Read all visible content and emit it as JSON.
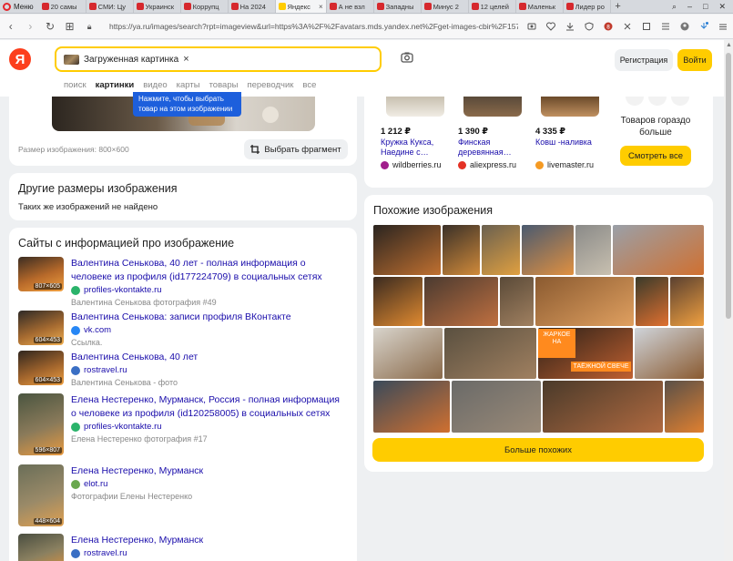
{
  "browser": {
    "menu_label": "Меню",
    "tabs": [
      {
        "title": "20 самы",
        "fav": "red"
      },
      {
        "title": "СМИ: Цу",
        "fav": "red"
      },
      {
        "title": "Украинск",
        "fav": "red"
      },
      {
        "title": "Коррупц",
        "fav": "red"
      },
      {
        "title": "На 2024",
        "fav": "red"
      },
      {
        "title": "Яндекс",
        "fav": "ya",
        "active": true
      },
      {
        "title": "А не взл",
        "fav": "red"
      },
      {
        "title": "Западны",
        "fav": "red"
      },
      {
        "title": "Минус 2",
        "fav": "red"
      },
      {
        "title": "12 целей",
        "fav": "red"
      },
      {
        "title": "Маленьк",
        "fav": "red"
      },
      {
        "title": "Лидер ро",
        "fav": "red"
      }
    ],
    "url": "https://ya.ru/images/search?rpt=imageview&url=https%3A%2F%2Favatars.mds.yandex.net%2Fget-images-cbir%2F1574220%2F1WjvlvL",
    "tab_close": "×",
    "new_tab": "+"
  },
  "header": {
    "logo": "Я",
    "search_chip": "Загруженная картинка",
    "chip_close": "×",
    "register": "Регистрация",
    "login": "Войти",
    "nav": [
      "поиск",
      "картинки",
      "видео",
      "карты",
      "товары",
      "переводчик",
      "все"
    ],
    "active_nav": "картинки"
  },
  "source": {
    "hint": "Нажмите, чтобы выбрать товар на этом изображении",
    "size_text": "Размер изображения: 800×600",
    "fragment_button": "Выбрать фрагмент"
  },
  "other_sizes": {
    "title": "Другие размеры изображения",
    "empty": "Таких же изображений не найдено"
  },
  "sites": {
    "title": "Сайты с информацией про изображение",
    "items": [
      {
        "title": "Валентина Сенькова, 40 лет - полная информация о человеке из профиля (id177224709) в социальных сетях",
        "domain": "profiles-vkontakte.ru",
        "snippet": "Валентина Сенькова фотография #49",
        "dim": "807×605",
        "fav_color": "#2ab36a"
      },
      {
        "title": "Валентина Сенькова: записи профиля ВКонтакте",
        "domain": "vk.com",
        "snippet": "Ссылка.",
        "dim": "604×453",
        "fav_color": "#2787f5"
      },
      {
        "title": "Валентина Сенькова, 40 лет",
        "domain": "rostravel.ru",
        "snippet": "Валентина Сенькова - фото",
        "dim": "604×453",
        "fav_color": "#3a6fc4"
      },
      {
        "title": "Елена Нестеренко, Мурманск, Россия - полная информация о человеке из профиля (id120258005) в социальных сетях",
        "domain": "profiles-vkontakte.ru",
        "snippet": "Елена Нестеренко фотография #17",
        "dim": "596×807",
        "fav_color": "#2ab36a"
      },
      {
        "title": "Елена Нестеренко, Мурманск",
        "domain": "elot.ru",
        "snippet": "Фотографии Елены Нестеренко",
        "dim": "448×604",
        "fav_color": "#6aa84f"
      },
      {
        "title": "Елена Нестеренко, Мурманск",
        "domain": "rostravel.ru",
        "snippet": "",
        "dim": "",
        "fav_color": "#3a6fc4"
      }
    ]
  },
  "products": {
    "items": [
      {
        "price": "1 212 ₽",
        "name": "Кружка Кукса, Наедине с…",
        "shop": "wildberries.ru",
        "shop_color": "#a11e8c"
      },
      {
        "price": "1 390 ₽",
        "name": "Финская деревянная…",
        "shop": "aliexpress.ru",
        "shop_color": "#e43225"
      },
      {
        "price": "4 335 ₽",
        "name": "Ковш -наливка",
        "shop": "livemaster.ru",
        "shop_color": "#f59a23"
      }
    ],
    "more_text": "Товаров гораздо больше",
    "see_all": "Смотреть все"
  },
  "similar": {
    "title": "Похожие изображения",
    "badge_top": "ЖАРКОЕ НА",
    "badge_bottom": "ТАЁЖНОЙ СВЕЧЕ",
    "more_button": "Больше похожих"
  },
  "colors": {
    "accent_yellow": "#ffcc00",
    "yandex_red": "#fc3f1d",
    "link_blue": "#1a0dab",
    "hint_blue": "#1d5fdc"
  }
}
